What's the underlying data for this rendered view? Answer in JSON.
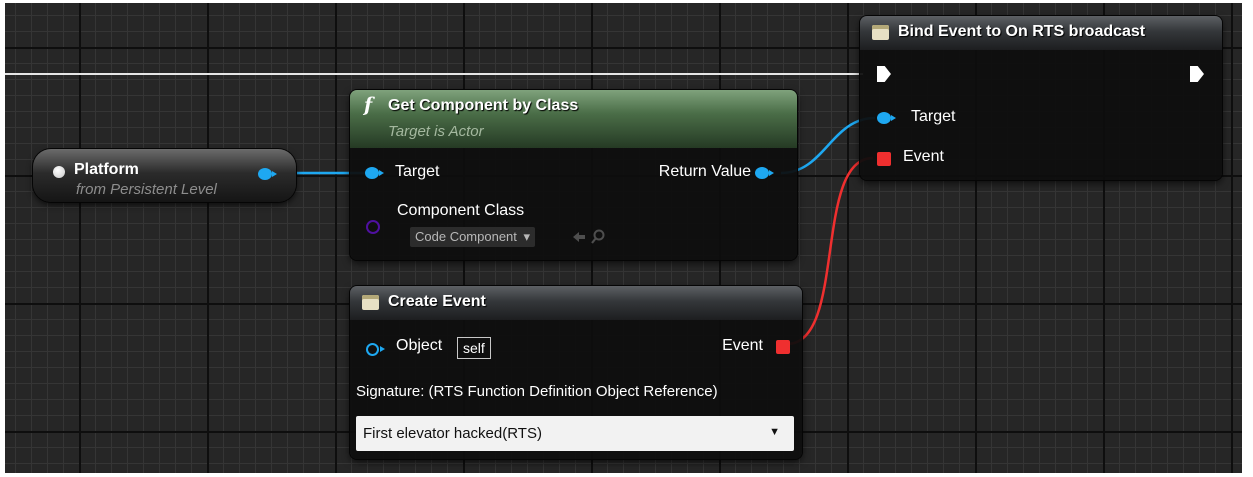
{
  "variable_node": {
    "title": "Platform",
    "subtitle": "from Persistent Level"
  },
  "get_component_node": {
    "title": "Get Component by Class",
    "subtitle": "Target is Actor",
    "pins": {
      "target": "Target",
      "return_value": "Return Value",
      "component_class": "Component Class"
    },
    "component_class_value": "Code Component",
    "combo_arrow": "▾",
    "icons": [
      "function-icon",
      "browse-icon",
      "search-icon"
    ]
  },
  "create_event_node": {
    "title": "Create Event",
    "pins": {
      "object": "Object",
      "object_default": "self",
      "event": "Event"
    },
    "signature": "Signature: (RTS Function Definition Object Reference)",
    "selected_function": "First elevator hacked(RTS)",
    "dropdown_arrow": "▼"
  },
  "bind_event_node": {
    "title": "Bind Event to On RTS broadcast",
    "pins": {
      "target": "Target",
      "event": "Event"
    }
  },
  "colors": {
    "object_wire": "#1ea8f1",
    "delegate_wire": "#ef2f2f",
    "exec_wire": "#ffffff",
    "class_pin": "#4f10a0",
    "function_header": "#4b6e48"
  }
}
